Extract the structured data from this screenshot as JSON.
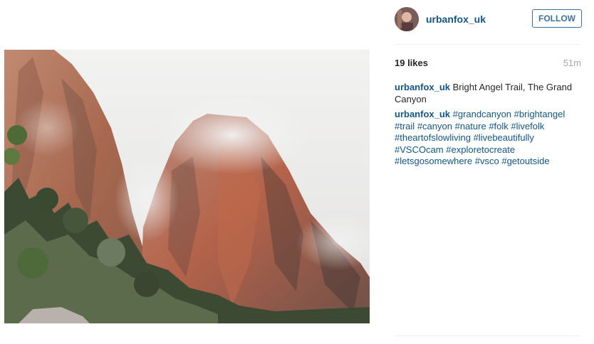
{
  "post": {
    "username": "urbanfox_uk",
    "follow_label": "FOLLOW",
    "likes": "19 likes",
    "time": "51m",
    "caption_text": "Bright Angel Trail, The Grand Canyon"
  },
  "comment": {
    "username": "urbanfox_uk",
    "hashtags": [
      "#grandcanyon",
      "#brightangel",
      "#trail",
      "#canyon",
      "#nature",
      "#folk",
      "#livefolk",
      "#theartofslowliving",
      "#livebeautifully",
      "#VSCOcam",
      "#exploretocreate",
      "#letsgosomewhere",
      "#vsco",
      "#getoutside"
    ]
  },
  "colors": {
    "link": "#125688",
    "follow_border": "#3f729b",
    "muted": "#a5a7aa"
  }
}
